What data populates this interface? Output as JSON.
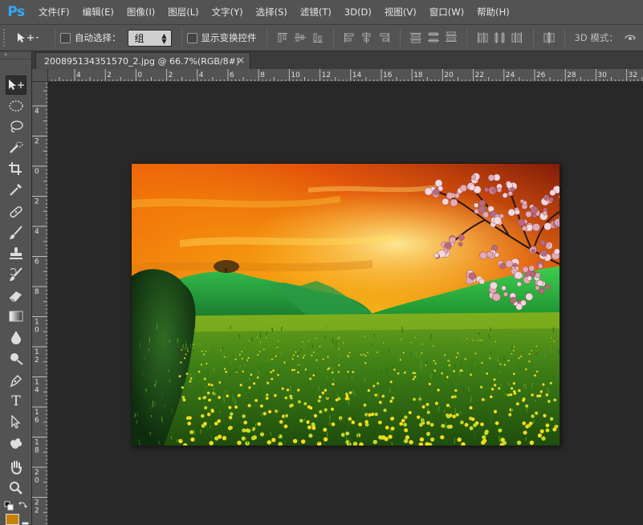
{
  "app": {
    "logo_text": "Ps"
  },
  "menu": [
    "文件(F)",
    "编辑(E)",
    "图像(I)",
    "图层(L)",
    "文字(Y)",
    "选择(S)",
    "滤镜(T)",
    "3D(D)",
    "视图(V)",
    "窗口(W)",
    "帮助(H)"
  ],
  "options": {
    "auto_select_label": "自动选择：",
    "auto_select_value": "组",
    "show_transform_label": "显示变换控件",
    "mode_3d_label": "3D 模式："
  },
  "document": {
    "tab_title": "200895134351570_2.jpg @ 66.7%(RGB/8#)",
    "close_glyph": "×"
  },
  "rulers": {
    "horizontal": [
      "4",
      "2",
      "0",
      "2",
      "4",
      "6",
      "8",
      "10",
      "12",
      "14",
      "16",
      "18",
      "20",
      "22",
      "24",
      "26",
      "28",
      "30",
      "32"
    ],
    "vertical": [
      "4",
      "2",
      "0",
      "2",
      "4",
      "6",
      "8",
      "1 0",
      "1 2",
      "1 4",
      "1 6",
      "1 8",
      "2 0",
      "2 2"
    ]
  },
  "colors": {
    "foreground": "#c8820a",
    "background": "#ffffff",
    "ui_panel": "#535353",
    "workspace": "#282828",
    "logo_blue": "#31a8ff"
  },
  "tools": [
    "move-tool",
    "marquee-tool",
    "lasso-tool",
    "quick-selection-tool",
    "crop-tool",
    "eyedropper-tool",
    "healing-brush-tool",
    "brush-tool",
    "clone-stamp-tool",
    "history-brush-tool",
    "eraser-tool",
    "gradient-tool",
    "blur-tool",
    "dodge-tool",
    "pen-tool",
    "type-tool",
    "path-selection-tool",
    "custom-shape-tool",
    "hand-tool",
    "zoom-tool"
  ],
  "tool_glyphs": {
    "type-tool": "T"
  }
}
